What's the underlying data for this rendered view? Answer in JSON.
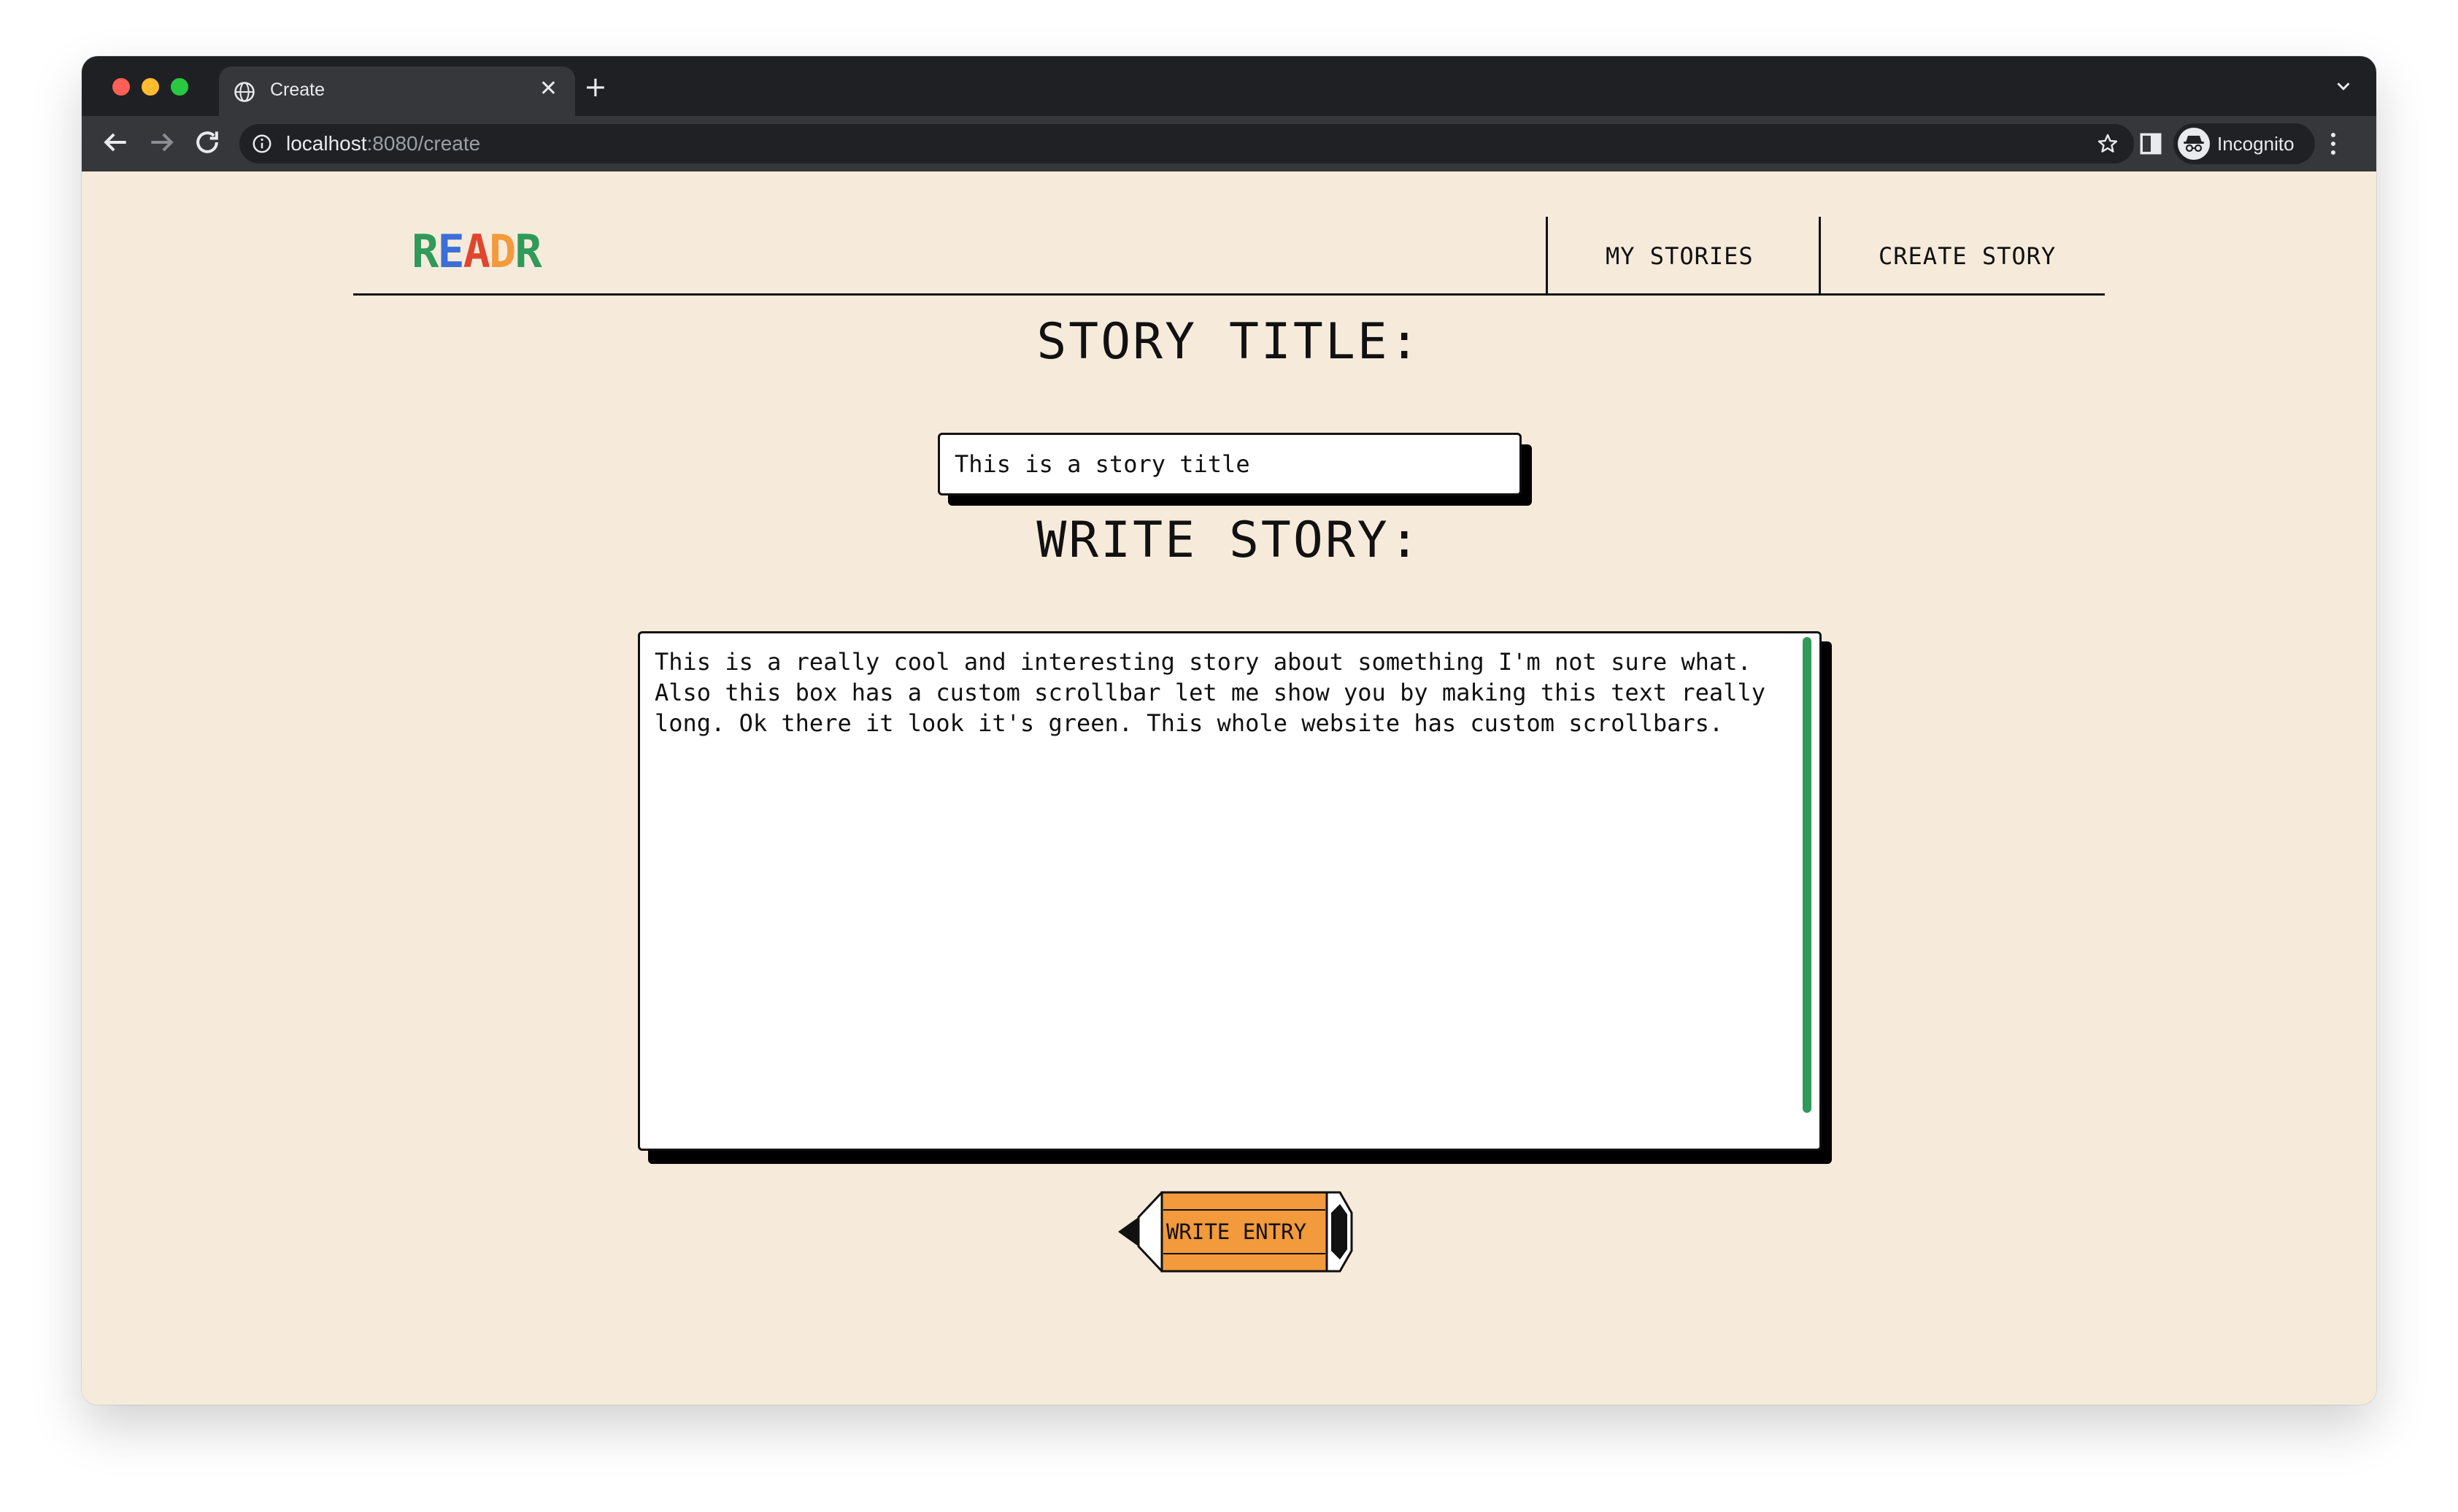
{
  "browser": {
    "tab_title": "Create",
    "url_host": "localhost",
    "url_path": ":8080/create",
    "profile_label": "Incognito"
  },
  "site": {
    "logo": {
      "letters": [
        "R",
        "E",
        "A",
        "D",
        "R"
      ],
      "colors": [
        "#2f9a59",
        "#3a6fd8",
        "#e0452d",
        "#f39a3c",
        "#2f9a59"
      ]
    },
    "nav": {
      "my_stories": "MY STORIES",
      "create_story": "CREATE STORY"
    }
  },
  "form": {
    "title_heading": "STORY TITLE:",
    "title_value": "This is a story title",
    "story_heading": "WRITE STORY:",
    "story_value": "This is a really cool and interesting story about something I'm not sure what.\nAlso this box has a custom scrollbar let me show you by making this text really\nlong. Ok there it look it's green. This whole website has custom scrollbars.",
    "submit_label": "WRITE ENTRY"
  },
  "colors": {
    "page_background": "#f6ebdb",
    "scrollbar": "#2f9a59",
    "button": "#f39a3c"
  }
}
